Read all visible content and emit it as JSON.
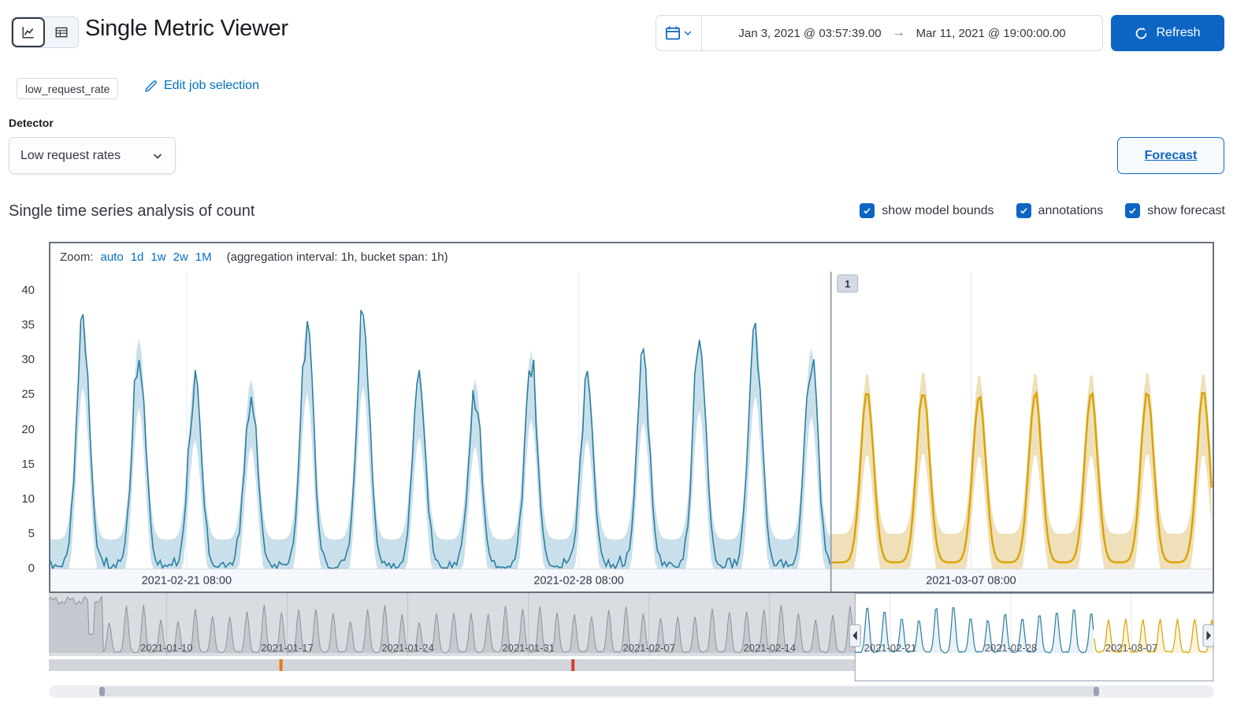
{
  "header": {
    "title": "Single Metric Viewer",
    "refresh": "Refresh",
    "date_start": "Jan 3, 2021 @ 03:57:39.00",
    "date_arrow": "→",
    "date_end": "Mar 11, 2021 @ 19:00:00.00"
  },
  "job_bar": {
    "badge": "low_request_rate",
    "edit_link": "Edit job selection"
  },
  "detector": {
    "label": "Detector",
    "selected": "Low request rates"
  },
  "forecast_button": "Forecast",
  "analysis": {
    "heading": "Single time series analysis of count",
    "checkboxes": [
      {
        "label": "show model bounds",
        "checked": true
      },
      {
        "label": "annotations",
        "checked": true
      },
      {
        "label": "show forecast",
        "checked": true
      }
    ]
  },
  "zoom_bar": {
    "label": "Zoom:",
    "options": [
      "auto",
      "1d",
      "1w",
      "2w",
      "1M"
    ],
    "note": "(aggregation interval: 1h, bucket span: 1h)"
  },
  "chart_data": {
    "type": "line",
    "metric": "count",
    "ylim": [
      0,
      40
    ],
    "yticks": [
      0,
      5,
      10,
      15,
      20,
      25,
      30,
      35,
      40
    ],
    "xticks": [
      {
        "label": "2021-02-21 08:00",
        "day": 2.43
      },
      {
        "label": "2021-02-28 08:00",
        "day": 9.43
      },
      {
        "label": "2021-03-07 08:00",
        "day": 16.43
      }
    ],
    "span_days": 20.74,
    "forecast_start_day": 13.93,
    "first_peak_day": 0.58,
    "bucket_span": "1h",
    "series": [
      {
        "name": "actual",
        "type": "line",
        "color": "#2d7ea0",
        "day_peak_values": [
          35,
          31.5,
          26,
          25,
          34,
          35,
          26.5,
          25,
          29.5,
          26,
          29,
          31,
          33.5,
          30
        ]
      },
      {
        "name": "model bounds",
        "type": "band",
        "color": "#c9e0eb"
      },
      {
        "name": "forecast",
        "type": "line",
        "color": "#d9a300",
        "day_peak_values": [
          24.5,
          24.8,
          24.3,
          24.6,
          24.4,
          24.7,
          24.5
        ]
      },
      {
        "name": "forecast bounds",
        "type": "band",
        "color": "#efe0ba"
      }
    ],
    "annotations": [
      {
        "id": "1",
        "day": 13.93
      }
    ]
  },
  "navigator": {
    "span_days": 67.63,
    "selection_start_day": 46.79,
    "forecast_start_day": 60.67,
    "ticks": [
      {
        "label": "2021-01-10",
        "day": 6.83
      },
      {
        "label": "2021-01-17",
        "day": 13.83
      },
      {
        "label": "2021-01-24",
        "day": 20.83
      },
      {
        "label": "2021-01-31",
        "day": 27.83
      },
      {
        "label": "2021-02-07",
        "day": 34.83
      },
      {
        "label": "2021-02-14",
        "day": 41.83
      },
      {
        "label": "2021-02-21",
        "day": 48.83
      },
      {
        "label": "2021-02-28",
        "day": 55.83
      },
      {
        "label": "2021-03-07",
        "day": 62.83
      }
    ],
    "annotation_marks": [
      {
        "day": 13.47,
        "color": "#e8781d"
      },
      {
        "day": 30.42,
        "color": "#da3b2f"
      }
    ]
  },
  "colors": {
    "primary": "#0d65c3",
    "link": "#0071c2",
    "actual_line": "#2d7ea0",
    "bounds_fill": "#c9e0eb",
    "forecast_line": "#d9a300",
    "forecast_fill": "#efe0ba"
  }
}
